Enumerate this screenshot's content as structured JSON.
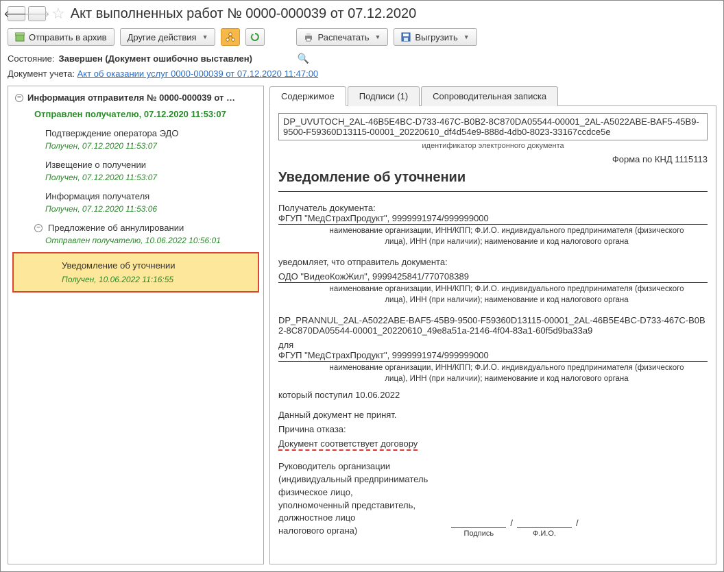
{
  "header": {
    "title": "Акт выполненных работ № 0000-000039 от 07.12.2020"
  },
  "toolbar": {
    "archive": "Отправить в архив",
    "other_actions": "Другие действия",
    "print": "Распечатать",
    "export": "Выгрузить"
  },
  "status": {
    "label": "Состояние:",
    "value": "Завершен (Документ ошибочно выставлен)"
  },
  "doc_ref": {
    "label": "Документ учета:",
    "link": "Акт об оказании услуг 0000-000039 от 07.12.2020 11:47:00"
  },
  "tree": {
    "root_title": "Информация отправителя № 0000-000039 от …",
    "root_status": "Отправлен получателю, 07.12.2020 11:53:07",
    "items": [
      {
        "title": "Подтверждение оператора ЭДО",
        "status": "Получен, 07.12.2020 11:53:07"
      },
      {
        "title": "Извещение о получении",
        "status": "Получен, 07.12.2020 11:53:07"
      },
      {
        "title": "Информация получателя",
        "status": "Получен, 07.12.2020 11:53:06"
      }
    ],
    "annul": {
      "title": "Предложение об аннулировании",
      "status": "Отправлен получателю, 10.06.2022 10:56:01"
    },
    "highlight": {
      "title": "Уведомление об уточнении",
      "status": "Получен, 10.06.2022 11:16:55"
    }
  },
  "tabs": {
    "content": "Содержимое",
    "signatures": "Подписи (1)",
    "note": "Сопроводительная записка"
  },
  "document": {
    "file_id": "DP_UVUTOCH_2AL-46B5E4BC-D733-467C-B0B2-8C870DA05544-00001_2AL-A5022ABE-BAF5-45B9-9500-F59360D13115-00001_20220610_df4d54e9-888d-4db0-8023-33167ccdce5e",
    "file_id_caption": "идентификатор электронного документа",
    "form_code": "Форма по КНД 1115113",
    "heading": "Уведомление об уточнении",
    "recipient_label": "Получатель документа:",
    "recipient_value": "ФГУП \"МедСтрахПродукт\", 9999991974/999999000",
    "org_caption": "наименование организации, ИНН/КПП; Ф.И.О. индивидуального предпринимателя (физического лица), ИНН (при наличии); наименование и код налогового органа",
    "sender_intro": "уведомляет, что отправитель документа:",
    "sender_value": "ОДО \"ВидеоКожЖил\", 9999425841/770708389",
    "prannul_id": "DP_PRANNUL_2AL-A5022ABE-BAF5-45B9-9500-F59360D13115-00001_2AL-46B5E4BC-D733-467C-B0B2-8C870DA05544-00001_20220610_49e8a51a-2146-4f04-83a1-60f5d9ba33a9",
    "for_label": "для",
    "for_value": "ФГУП \"МедСтрахПродукт\", 9999991974/999999000",
    "received_on": "который поступил 10.06.2022",
    "not_accepted": "Данный документ не принят.",
    "reason_label": "Причина отказа:",
    "reason_value": "Документ соответствует договору",
    "signer_role": "Руководитель  организации\n(индивидуальный предприниматель\nфизическое лицо,\nуполномоченный представитель,\nдолжностное лицо\nналогового органа)",
    "sig_caption1": "Подпись",
    "sig_caption2": "Ф.И.О."
  }
}
